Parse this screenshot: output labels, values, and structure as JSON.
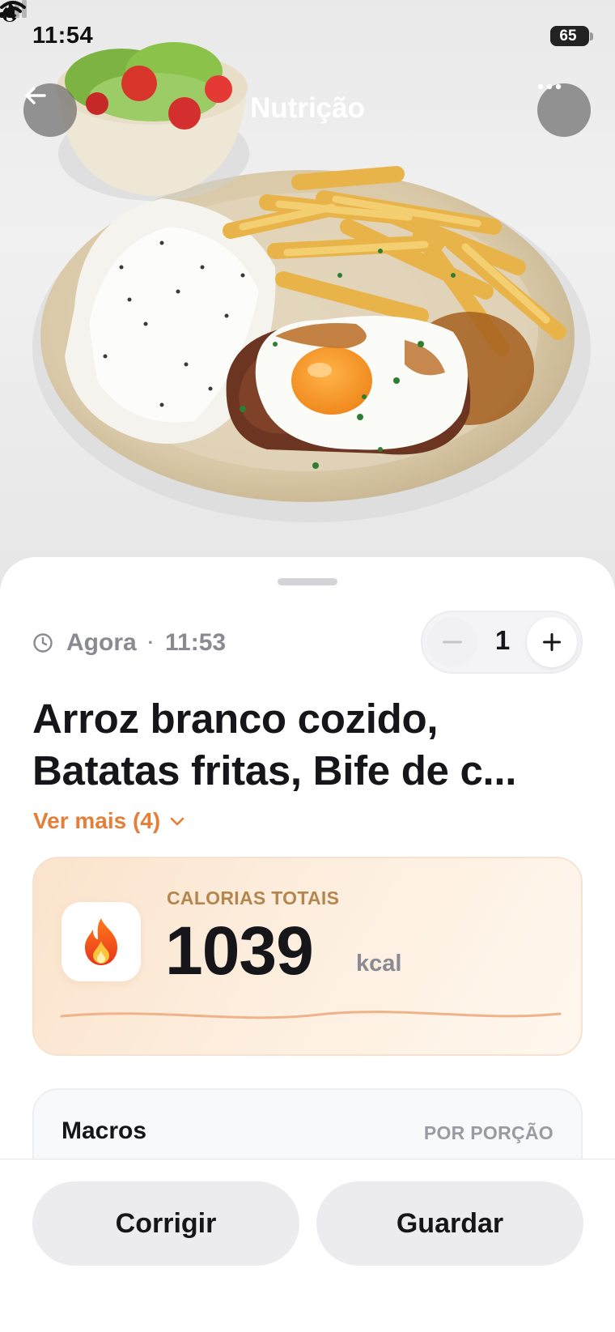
{
  "status_bar": {
    "time": "11:54",
    "battery": "65",
    "battery_percent": 65
  },
  "nav": {
    "title": "Nutrição",
    "back_icon": "arrow-left-icon",
    "more_icon": "more-horizontal-icon"
  },
  "meal": {
    "when_label": "Agora",
    "time": "11:53",
    "quantity": "1",
    "title_line1": "Arroz branco cozido,",
    "title_line2": "Batatas fritas, Bife de c...",
    "see_more": "Ver mais (4)"
  },
  "calories": {
    "label": "CALORIAS TOTAIS",
    "value": "1039",
    "unit": "kcal",
    "icon": "flame-icon"
  },
  "macros": {
    "title": "Macros",
    "subtitle": "POR PORÇÃO"
  },
  "actions": {
    "fix_label": "Corrigir",
    "save_label": "Guardar"
  },
  "colors": {
    "accent": "#e57e36",
    "calorie_card": "#fdeede",
    "button_bg": "#ececef"
  }
}
